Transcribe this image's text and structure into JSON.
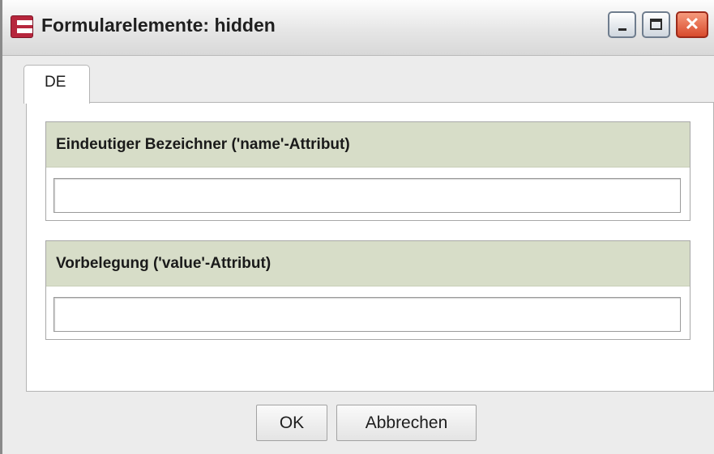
{
  "window": {
    "title": "Formularelemente: hidden",
    "app_icon": "app-logo-icon",
    "controls": {
      "minimize_icon": "minimize-icon",
      "maximize_icon": "maximize-icon",
      "close_icon": "close-icon",
      "close_glyph": "✕"
    },
    "colors": {
      "close_button": "#d84a2c",
      "group_header": "#d7ddc8",
      "app_icon": "#b6263c"
    }
  },
  "tabs": [
    {
      "label": "DE",
      "selected": true
    }
  ],
  "form": {
    "groups": [
      {
        "label": "Eindeutiger Bezeichner ('name'-Attribut)",
        "value": "",
        "placeholder": ""
      },
      {
        "label": "Vorbelegung ('value'-Attribut)",
        "value": "",
        "placeholder": ""
      }
    ]
  },
  "buttons": {
    "ok": "OK",
    "cancel": "Abbrechen"
  }
}
